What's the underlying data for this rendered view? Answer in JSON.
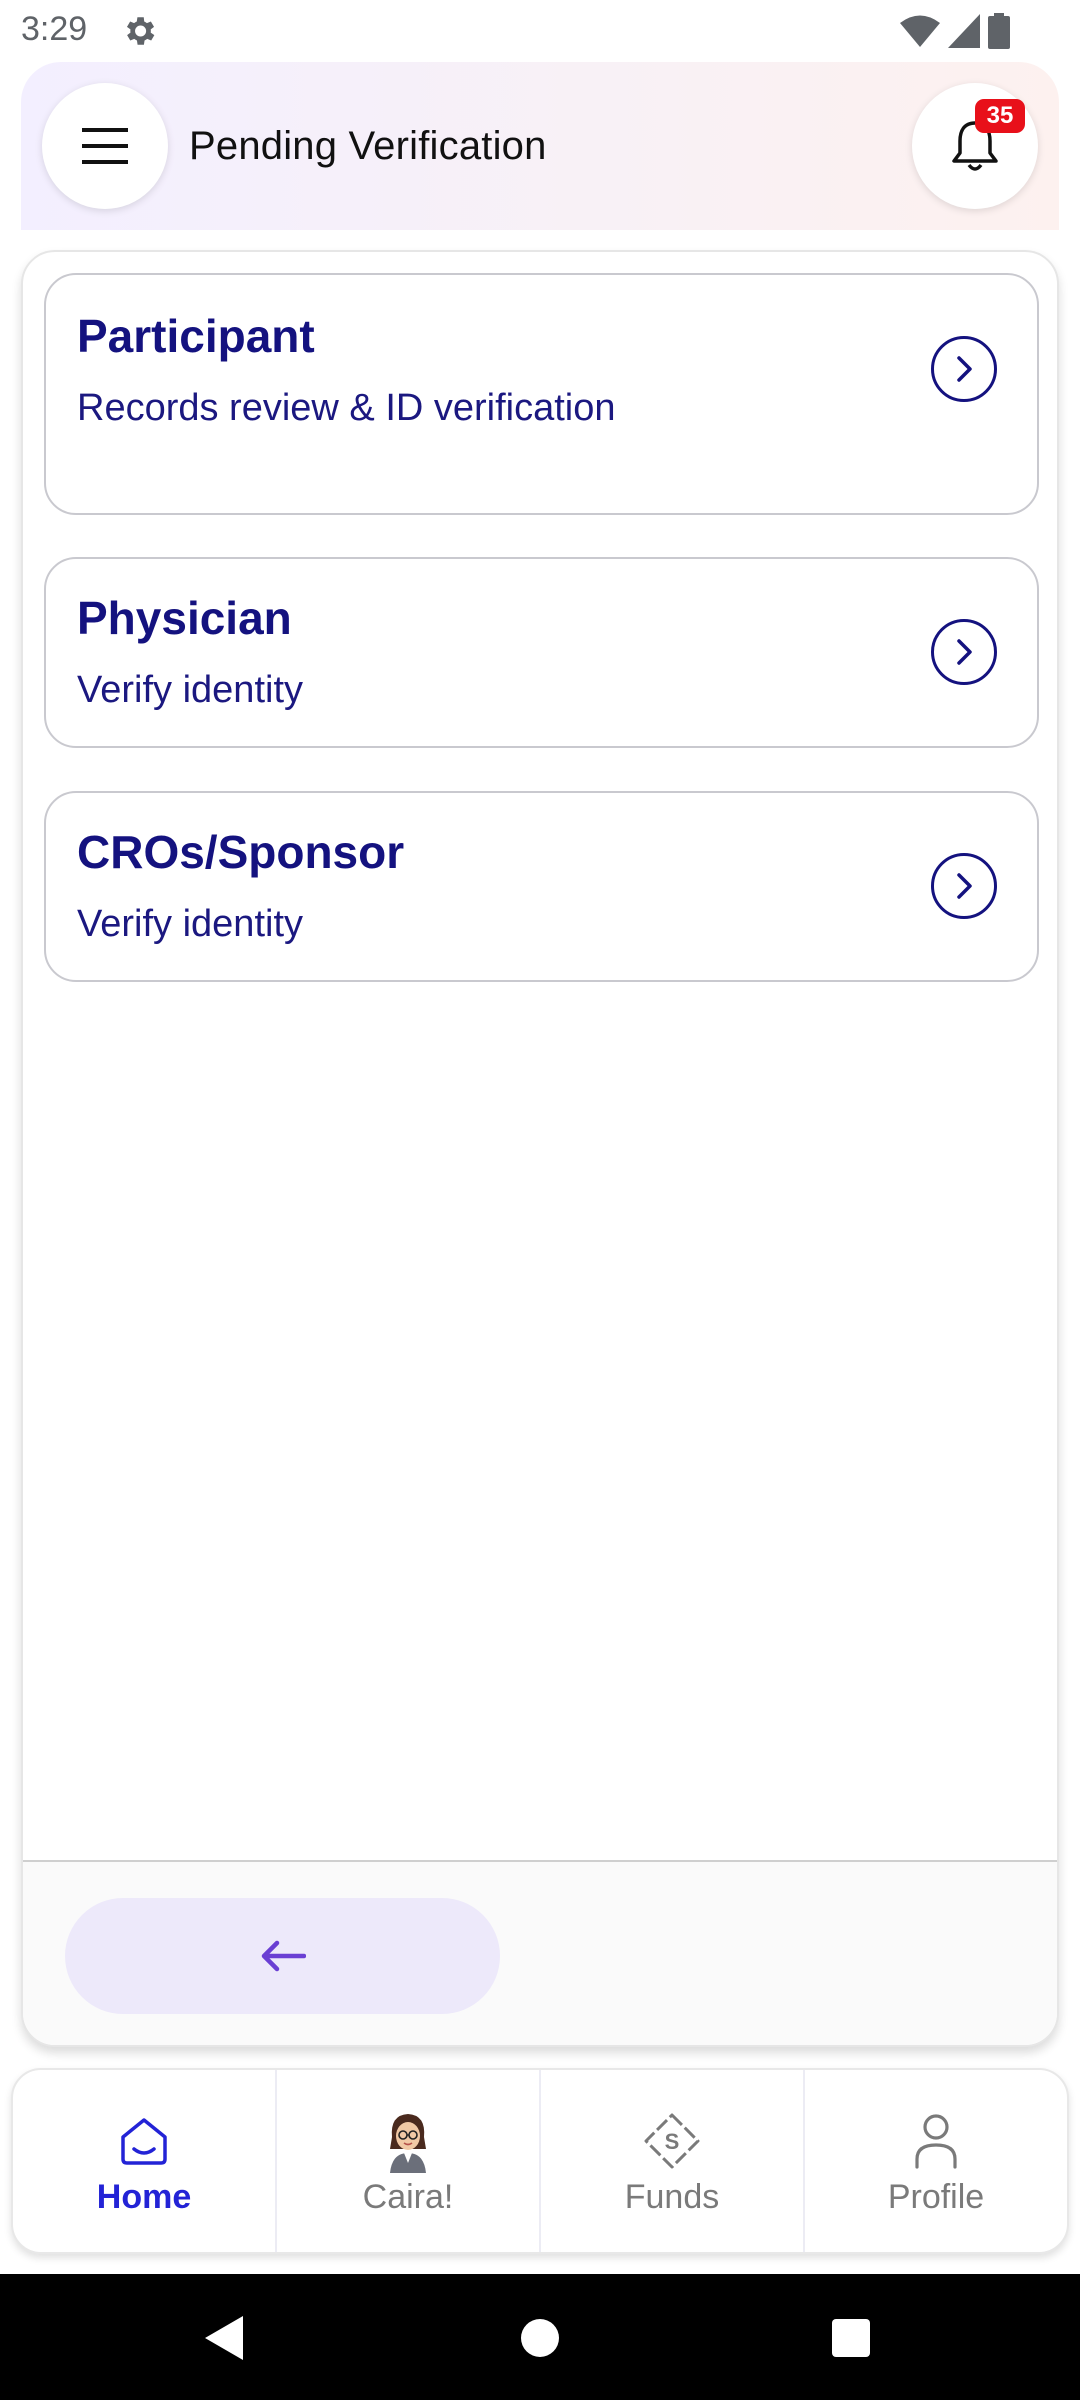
{
  "status_bar": {
    "time": "3:29",
    "icons": [
      "settings-gear-icon",
      "wifi-icon",
      "cell-signal-icon",
      "battery-icon"
    ]
  },
  "header": {
    "title": "Pending Verification",
    "notification_count": "35",
    "menu_icon": "hamburger-menu-icon",
    "bell_icon": "bell-icon"
  },
  "items": [
    {
      "title": "Participant",
      "subtitle": "Records review & ID verification",
      "arrow_icon": "chevron-right-circle-icon"
    },
    {
      "title": "Physician",
      "subtitle": "Verify identity",
      "arrow_icon": "chevron-right-circle-icon"
    },
    {
      "title": "CROs/Sponsor",
      "subtitle": "Verify identity",
      "arrow_icon": "chevron-right-circle-icon"
    }
  ],
  "footer": {
    "back_icon": "arrow-left-icon"
  },
  "bottom_nav": {
    "items": [
      {
        "label": "Home",
        "icon": "home-icon",
        "active": true
      },
      {
        "label": "Caira!",
        "icon": "caira-avatar-icon",
        "active": false
      },
      {
        "label": "Funds",
        "icon": "funds-diamond-icon",
        "active": false
      },
      {
        "label": "Profile",
        "icon": "person-icon",
        "active": false
      }
    ]
  },
  "colors": {
    "primary_text": "#14127f",
    "accent": "#2323d6",
    "badge": "#e8101a",
    "back_button_bg": "#ede9fa",
    "back_arrow": "#6a3fd3"
  }
}
